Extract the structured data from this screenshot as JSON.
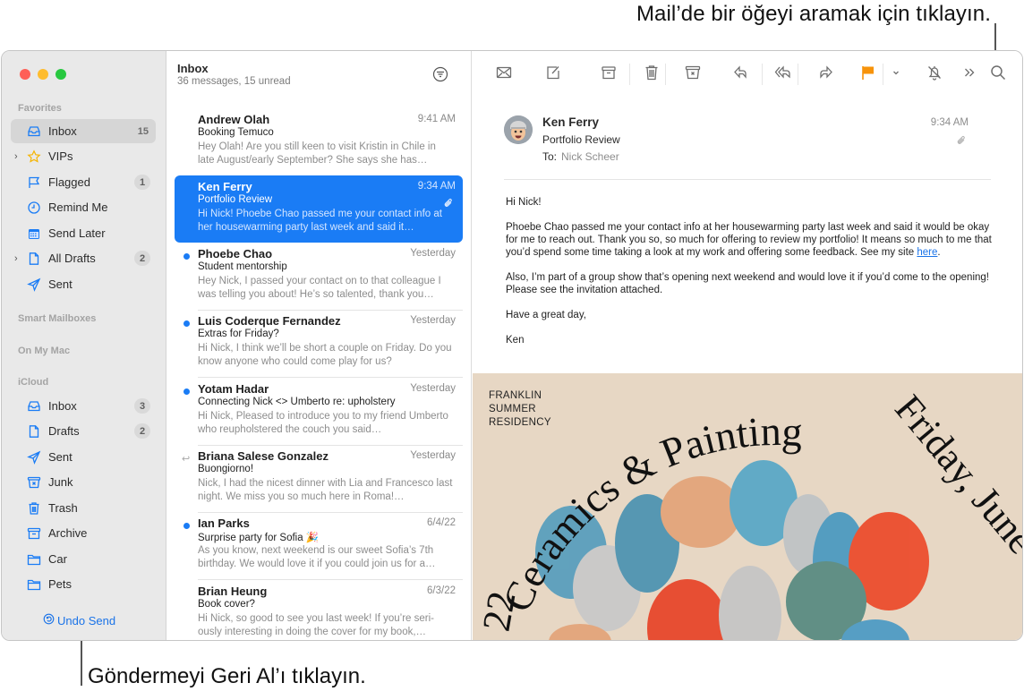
{
  "callouts": {
    "search": "Mail’de bir öğeyi aramak için tıklayın.",
    "undo": "Göndermeyi Geri Al’ı tıklayın."
  },
  "colors": {
    "accent": "#1a7cf5",
    "flag": "#f7930a",
    "sidebar_bg": "#e9e9e9",
    "poster_bg": "#e7d7c4"
  },
  "sidebar": {
    "sections": {
      "favorites": "Favorites",
      "smart": "Smart Mailboxes",
      "mac": "On My Mac",
      "icloud": "iCloud"
    },
    "favorites": [
      {
        "label": "Inbox",
        "icon": "inbox-icon",
        "count": "15",
        "active": true
      },
      {
        "label": "VIPs",
        "icon": "star-icon",
        "expandable": true
      },
      {
        "label": "Flagged",
        "icon": "flag-icon",
        "badge": "1"
      },
      {
        "label": "Remind Me",
        "icon": "clock-icon"
      },
      {
        "label": "Send Later",
        "icon": "calendar-icon"
      },
      {
        "label": "All Drafts",
        "icon": "document-icon",
        "badge": "2",
        "expandable": true
      },
      {
        "label": "Sent",
        "icon": "paper-plane-icon"
      }
    ],
    "icloud": [
      {
        "label": "Inbox",
        "icon": "inbox-icon",
        "badge": "3"
      },
      {
        "label": "Drafts",
        "icon": "document-icon",
        "badge": "2"
      },
      {
        "label": "Sent",
        "icon": "paper-plane-icon"
      },
      {
        "label": "Junk",
        "icon": "junk-icon"
      },
      {
        "label": "Trash",
        "icon": "trash-icon"
      },
      {
        "label": "Archive",
        "icon": "archive-icon"
      },
      {
        "label": "Car",
        "icon": "folder-icon"
      },
      {
        "label": "Pets",
        "icon": "folder-icon"
      }
    ],
    "undo_send": "Undo Send"
  },
  "list": {
    "title": "Inbox",
    "subtitle": "36 messages, 15 unread",
    "messages": [
      {
        "from": "Andrew Olah",
        "date": "9:41 AM",
        "subject": "Booking Temuco",
        "preview": "Hey Olah! Are you still keen to visit Kristin in Chile in late August/early September? She says she has…",
        "unread": false
      },
      {
        "from": "Ken Ferry",
        "date": "9:34 AM",
        "subject": "Portfolio Review",
        "preview": "Hi Nick! Phoebe Chao passed me your contact info at her housewarming party last week and said it…",
        "unread": false,
        "selected": true,
        "attachment": true
      },
      {
        "from": "Phoebe Chao",
        "date": "Yesterday",
        "subject": "Student mentorship",
        "preview": "Hey Nick, I passed your contact on to that colleague I was telling you about! He’s so talented, thank you…",
        "unread": true
      },
      {
        "from": "Luis Coderque Fernandez",
        "date": "Yesterday",
        "subject": "Extras for Friday?",
        "preview": "Hi Nick, I think we’ll be short a couple on Friday. Do you know anyone who could come play for us?",
        "unread": true
      },
      {
        "from": "Yotam Hadar",
        "date": "Yesterday",
        "subject": "Connecting Nick <> Umberto re: upholstery",
        "preview": "Hi Nick, Pleased to introduce you to my friend Umberto who reupholstered the couch you said…",
        "unread": true
      },
      {
        "from": "Briana Salese Gonzalez",
        "date": "Yesterday",
        "subject": "Buongiorno!",
        "preview": "Nick, I had the nicest dinner with Lia and Francesco last night. We miss you so much here in Roma!…",
        "unread": false,
        "replied": true
      },
      {
        "from": "Ian Parks",
        "date": "6/4/22",
        "subject": "Surprise party for Sofia 🎉",
        "preview": "As you know, next weekend is our sweet Sofia’s 7th birthday. We would love it if you could join us for a…",
        "unread": true
      },
      {
        "from": "Brian Heung",
        "date": "6/3/22",
        "subject": "Book cover?",
        "preview": "Hi Nick, so good to see you last week! If you’re seri-ously interesting in doing the cover for my book,…",
        "unread": false
      }
    ]
  },
  "toolbar": {
    "buttons": [
      "get-mail",
      "compose",
      "archive",
      "delete",
      "junk",
      "reply",
      "reply-all",
      "forward",
      "flag",
      "flag-menu",
      "mute",
      "more",
      "search"
    ]
  },
  "reader": {
    "from": "Ken Ferry",
    "subject": "Portfolio Review",
    "to_label": "To:",
    "to": "Nick Scheer",
    "time": "9:34 AM",
    "body": {
      "greeting": "Hi Nick!",
      "p1": "Phoebe Chao passed me your contact info at her housewarming party last week and said it would be okay for me to reach out. Thank you so, so much for offering to review my portfolio! It means so much to me that you’d spend some time taking a look at my work and offering some feedback. See my site ",
      "link": "here",
      "p1_end": ".",
      "p2": "Also, I’m part of a group show that’s opening next weekend and would love it if you’d come to the opening! Please see the invitation attached.",
      "closing": "Have a great day,",
      "signature": "Ken"
    },
    "poster": {
      "org_line1": "FRANKLIN",
      "org_line2": "SUMMER",
      "org_line3": "RESIDENCY",
      "arc_title": "Ceramics & Painting",
      "arc_date": "Friday, June",
      "arc_year": "22"
    }
  }
}
